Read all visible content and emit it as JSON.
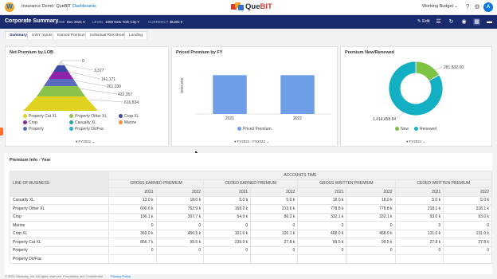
{
  "topbar": {
    "app_title": "Insurance Demo: QueBIT",
    "dashboards_link": "Dashboards",
    "brand_que": "Que",
    "brand_bit": "BIT",
    "budget_label": "Working Budget ⌄",
    "icons": [
      "help-icon",
      "settings-icon"
    ],
    "avatar_initial": "A"
  },
  "header": {
    "title": "Corporate Summary",
    "filters": [
      {
        "label": "TIME",
        "value": "Dec 2021 ▾"
      },
      {
        "label": "LEVEL",
        "value": "1000 New York City ▾"
      },
      {
        "label": "CURRENCY",
        "value": "$USD ▾"
      }
    ],
    "edit_label": "✎ Edit"
  },
  "tabs": [
    "Summary",
    "UWY Inputs",
    "Earned Premium",
    "Individual Risk Break...",
    "Landing"
  ],
  "net_premium": {
    "title": "Net Premium by LOB",
    "labels": [
      "0",
      "3,377",
      "141,171",
      "261,330",
      "432,357",
      "616,834"
    ],
    "legend": [
      {
        "name": "Property Cat XL",
        "color": "#e0d21f"
      },
      {
        "name": "Property Other XL",
        "color": "#8bc34a"
      },
      {
        "name": "Crop XL",
        "color": "#3a4aa5"
      },
      {
        "name": "Crop",
        "color": "#8e24aa"
      },
      {
        "name": "Casualty XL",
        "color": "#26a69a"
      },
      {
        "name": "Marine",
        "color": "#ff8a3d"
      },
      {
        "name": "Property",
        "color": "#5c6bc0"
      },
      {
        "name": "Property Dir/Fac",
        "color": "#20b2c8"
      }
    ],
    "filter": "▾ FY2021 ⌄"
  },
  "priced_premium": {
    "title": "Priced Premium by FY",
    "filter": "▾ FY2021 - FY2022 ⌄"
  },
  "premium_new": {
    "title": "Premium New/Renewed",
    "legend": [
      {
        "name": "New",
        "color": "#7dc242"
      },
      {
        "name": "Renewed",
        "color": "#13b0c4"
      }
    ],
    "filter": "▾ FY2021 ⌄"
  },
  "chart_data": [
    {
      "type": "bar",
      "title": "Priced Premium by FY",
      "categories": [
        "2021",
        "2022"
      ],
      "series": [
        {
          "name": "Priced Premium",
          "values": [
            1000000,
            1000000
          ],
          "color": "#6f9ee8"
        }
      ],
      "ylabel": "$000,000",
      "yticks": [
        "$000,000"
      ],
      "ylim": [
        0,
        1150000
      ]
    },
    {
      "type": "pie",
      "title": "Premium New/Renewed",
      "labels": [
        "New",
        "Renewed"
      ],
      "values": [
        281832,
        1414458.84
      ],
      "value_labels": [
        "281,832.00",
        "1,414,458.84"
      ],
      "colors": [
        "#7dc242",
        "#13b0c4"
      ]
    }
  ],
  "table": {
    "title": "Premium Info - Year",
    "group_header": "ACCOUNTS TIME",
    "lob_header": "LINE OF BUSINESS",
    "metrics": [
      "GROSS EARNED PREMIUM",
      "CEDED EARNED PREMIUM",
      "GROSS WRITTEN PREMIUM",
      "CEDED WRITTEN PREMIUM"
    ],
    "years": [
      "2021",
      "2022"
    ],
    "rows": [
      {
        "lob": "Casualty XL",
        "values": [
          "13.0 k",
          "18.0 k",
          "5.0 k",
          "5.0 k",
          "18.0 k",
          "18.0 k",
          "5.0 k",
          "5.0 k"
        ]
      },
      {
        "lob": "Property Other XL",
        "values": [
          "600.6 k",
          "762.9 k",
          "168.2 k",
          "213.6 k",
          "778.8 k",
          "778.8 k",
          "218.1 k",
          "218.1 k"
        ]
      },
      {
        "lob": "Crop",
        "values": [
          "196.1 k",
          "307.7 k",
          "54.9 k",
          "86.2 k",
          "332.1 k",
          "332.1 k",
          "93.0 k",
          "93.0 k"
        ]
      },
      {
        "lob": "Marine",
        "values": [
          "0",
          "0",
          "0",
          "0",
          "0",
          "0",
          "0",
          "0"
        ]
      },
      {
        "lob": "Crop XL",
        "values": [
          "363.0 k",
          "450.5 k",
          "101.6 k",
          "126.1 k",
          "468.0 k",
          "468.0 k",
          "131.0 k",
          "131.0 k"
        ]
      },
      {
        "lob": "Property Cat XL",
        "values": [
          "856.7 k",
          "99.5 k",
          "239.9 k",
          "27.8 k",
          "99.5 k",
          "99.5 k",
          "27.8 k",
          "27.8 k"
        ]
      },
      {
        "lob": "Property",
        "values": [
          "0",
          "0",
          "0",
          "0",
          "0",
          "0",
          "0",
          "0"
        ]
      },
      {
        "lob": "Property Dir/Fac",
        "values": [
          "",
          "",
          "",
          "",
          "",
          "",
          "",
          ""
        ]
      }
    ]
  },
  "footer": {
    "copyright": "© 2021 Workday, Inc. All rights reserved. Proprietary and Confidential.",
    "privacy": "Privacy Policy"
  }
}
